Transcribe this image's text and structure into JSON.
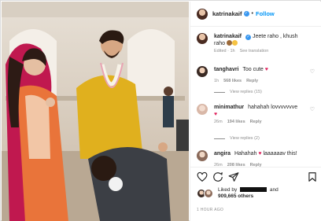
{
  "post": {
    "username": "katrinakaif",
    "follow_label": "Follow",
    "caption": "Jeete raho , khush raho",
    "caption_time": "Edited · 1h",
    "caption_translation": "See translation"
  },
  "comments": [
    {
      "user": "tanghavri",
      "text": "Too cute",
      "time": "1h",
      "likes": "568 likes",
      "reply": "Reply",
      "view_replies": "View replies (15)"
    },
    {
      "user": "minimathur",
      "text": "hahahah lovvvvvvve",
      "time": "26m",
      "likes": "194 likes",
      "reply": "Reply",
      "view_replies": "View replies (2)"
    },
    {
      "user": "angira",
      "text": "Hahahah",
      "text2": "laaaaaav this!",
      "time": "26m",
      "likes": "208 likes",
      "reply": "Reply"
    }
  ],
  "likes": {
    "prefix": "Liked by",
    "and": "and",
    "count": "909,665 others"
  },
  "timestamp": "1 HOUR AGO",
  "colors": {
    "accent": "#0095f6",
    "verified": "#3897f0",
    "heart": "#e0245e"
  }
}
